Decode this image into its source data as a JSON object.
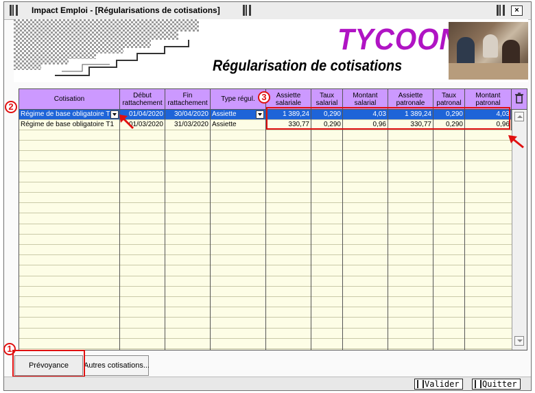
{
  "window": {
    "title": "Impact Emploi - [Régularisations de cotisations]",
    "close_symbol": "×"
  },
  "banner": {
    "brand": "TYCOON",
    "subtitle": "Régularisation de cotisations"
  },
  "grid": {
    "headers": [
      "Cotisation",
      "Début rattachement",
      "Fin rattachement",
      "Type régul.",
      "Assiette salariale",
      "Taux salarial",
      "Montant salarial",
      "Assiette patronale",
      "Taux patronal",
      "Montant patronal"
    ],
    "rows": [
      [
        "Régime de base obligatoire T1",
        "01/04/2020",
        "30/04/2020",
        "Assiette",
        "1 389,24",
        "0,290",
        "4,03",
        "1 389,24",
        "0,290",
        "4,03"
      ],
      [
        "Régime de base obligatoire T1",
        "01/03/2020",
        "31/03/2020",
        "Assiette",
        "330,77",
        "0,290",
        "0,96",
        "330,77",
        "0,290",
        "0,96"
      ]
    ],
    "selected_row": 0
  },
  "annotations": {
    "b1": "1",
    "b2": "2",
    "b3": "3"
  },
  "tabs": {
    "prevoyance": "Prévoyance",
    "autres": "Autres cotisations..."
  },
  "buttons": {
    "valider": "Valider",
    "quitter": "Quitter"
  },
  "colors": {
    "header_bg": "#cc99ff",
    "row_bg": "#fdfde6",
    "selection": "#1e64d8",
    "brand": "#b014c4",
    "annotation": "#e01010"
  }
}
